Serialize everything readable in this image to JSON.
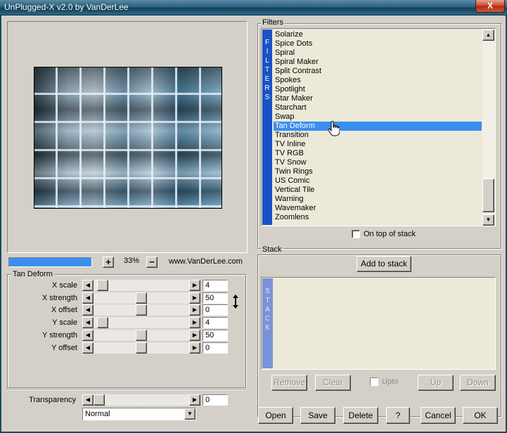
{
  "window": {
    "title": "UnPlugged-X v2.0 by VanDerLee",
    "close_label": "X"
  },
  "preview": {
    "progress_percent": 100,
    "zoom_minus": "−",
    "zoom_plus": "+",
    "zoom_level": "33%",
    "website": "www.VanDerLee.com"
  },
  "params": {
    "group_title": "Tan Deform",
    "rows": [
      {
        "label": "X scale",
        "value": "4",
        "level": 0.04
      },
      {
        "label": "X strength",
        "value": "50",
        "level": 0.5
      },
      {
        "label": "X offset",
        "value": "0",
        "level": 0.5
      },
      {
        "label": "Y scale",
        "value": "4",
        "level": 0.04
      },
      {
        "label": "Y strength",
        "value": "50",
        "level": 0.5
      },
      {
        "label": "Y offset",
        "value": "0",
        "level": 0.5
      }
    ],
    "transparency": {
      "label": "Transparency",
      "value": "0",
      "level": 0.0
    },
    "blend_mode": "Normal"
  },
  "filters": {
    "group_title": "Filters",
    "band_text": [
      "F",
      "I",
      "L",
      "T",
      "E",
      "R",
      "S"
    ],
    "items": [
      "Solarize",
      "Spice Dots",
      "Spiral",
      "Spiral Maker",
      "Split Contrast",
      "Spokes",
      "Spotlight",
      "Star Maker",
      "Starchart",
      "Swap",
      "Tan Deform",
      "Transition",
      "TV Inline",
      "TV RGB",
      "TV Snow",
      "Twin Rings",
      "US Comic",
      "Vertical Tile",
      "Warning",
      "Wavemaker",
      "Zoomlens"
    ],
    "selected": "Tan Deform",
    "on_top_label": "On top of stack",
    "on_top_checked": false
  },
  "stack": {
    "group_title": "Stack",
    "add_label": "Add to stack",
    "band_text": [
      "S",
      "T",
      "A",
      "C",
      "K"
    ],
    "remove_label": "Remove",
    "clear_label": "Clear",
    "upto_label": "Upto",
    "up_label": "Up",
    "down_label": "Down"
  },
  "footer": {
    "open": "Open",
    "save": "Save",
    "delete": "Delete",
    "help": "?",
    "cancel": "Cancel",
    "ok": "OK"
  },
  "colors": {
    "dialog_bg": "#d4d0c8",
    "selection": "#3a8ef0",
    "filters_band": "#1a52c6",
    "stack_band": "#7a92d8",
    "progress": "#3b8ff0"
  }
}
